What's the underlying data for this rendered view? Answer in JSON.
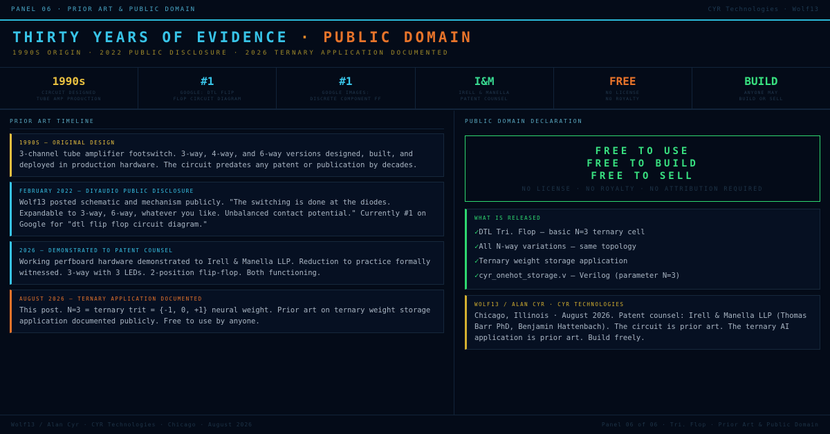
{
  "topbar": {
    "left": "PANEL 06 · PRIOR ART & PUBLIC DOMAIN",
    "right": "CYR Technologies · Wolf13"
  },
  "header": {
    "title_part1": "THIRTY YEARS OF EVIDENCE",
    "title_sep": " · ",
    "title_part2": "PUBLIC DOMAIN",
    "subtitle": "1990S ORIGIN · 2022 PUBLIC DISCLOSURE · 2026 TERNARY APPLICATION DOCUMENTED"
  },
  "stats": [
    {
      "value": "1990s",
      "label1": "CIRCUIT DESIGNED",
      "label2": "TUBE AMP PRODUCTION",
      "color": "#e8c040"
    },
    {
      "value": "#1",
      "label1": "GOOGLE: DTL FLIP",
      "label2": "FLOP CIRCUIT DIAGRAM",
      "color": "#38c4e8"
    },
    {
      "value": "#1",
      "label1": "GOOGLE IMAGES:",
      "label2": "DISCRETE COMPONENT FF",
      "color": "#38c4e8"
    },
    {
      "value": "I&M",
      "label1": "IRELL & MANELLA",
      "label2": "PATENT COUNSEL",
      "color": "#38d890"
    },
    {
      "value": "FREE",
      "label1": "NO LICENSE",
      "label2": "NO ROYALTY",
      "color": "#e8742a"
    },
    {
      "value": "BUILD",
      "label1": "ANYONE MAY",
      "label2": "BUILD OR SELL",
      "color": "#38e080"
    }
  ],
  "timeline": {
    "title": "PRIOR ART TIMELINE",
    "items": [
      {
        "heading": "1990S — ORIGINAL DESIGN",
        "body": "3-channel tube amplifier footswitch. 3-way, 4-way, and 6-way versions designed, built, and deployed in production hardware. The circuit predates any patent or publication by decades.",
        "color": "#e8c040"
      },
      {
        "heading": "FEBRUARY 2022 — DIYAUDIO PUBLIC DISCLOSURE",
        "body": "Wolf13 posted schematic and mechanism publicly. \"The switching is done at the diodes. Expandable to 3-way, 6-way, whatever you like. Unbalanced contact potential.\" Currently #1 on Google for \"dtl flip flop circuit diagram.\"",
        "color": "#38c4e8"
      },
      {
        "heading": "2026 — DEMONSTRATED TO PATENT COUNSEL",
        "body": "Working perfboard hardware demonstrated to Irell & Manella LLP. Reduction to practice formally witnessed. 3-way with 3 LEDs. 2-position flip-flop. Both functioning.",
        "color": "#38c4e8"
      },
      {
        "heading": "AUGUST 2026 — TERNARY APPLICATION DOCUMENTED",
        "body": "This post. N=3 = ternary trit = {-1, 0, +1} neural weight. Prior art on ternary weight storage application documented publicly. Free to use by anyone.",
        "color": "#e8742a"
      }
    ]
  },
  "declaration": {
    "title": "PUBLIC DOMAIN DECLARATION",
    "lines": [
      "FREE TO USE",
      "FREE TO BUILD",
      "FREE TO SELL"
    ],
    "note": "NO LICENSE · NO ROYALTY · NO ATTRIBUTION REQUIRED"
  },
  "released": {
    "title": "WHAT IS RELEASED",
    "check": "✓",
    "items": [
      "DTL Tri. Flop — basic N=3 ternary cell",
      "All N-way variations — same topology",
      "Ternary weight storage application",
      "cyr_onehot_storage.v — Verilog (parameter N=3)"
    ]
  },
  "author": {
    "title": "WOLF13 / ALAN CYR · CYR TECHNOLOGIES",
    "body": "Chicago, Illinois · August 2026. Patent counsel: Irell & Manella LLP (Thomas Barr PhD, Benjamin Hattenbach). The circuit is prior art. The ternary AI application is prior art. Build freely."
  },
  "footer": {
    "left": "Wolf13 / Alan Cyr · CYR Technologies · Chicago · August 2026",
    "right": "Panel 06 of 06 · Tri. Flop · Prior Art & Public Domain"
  }
}
